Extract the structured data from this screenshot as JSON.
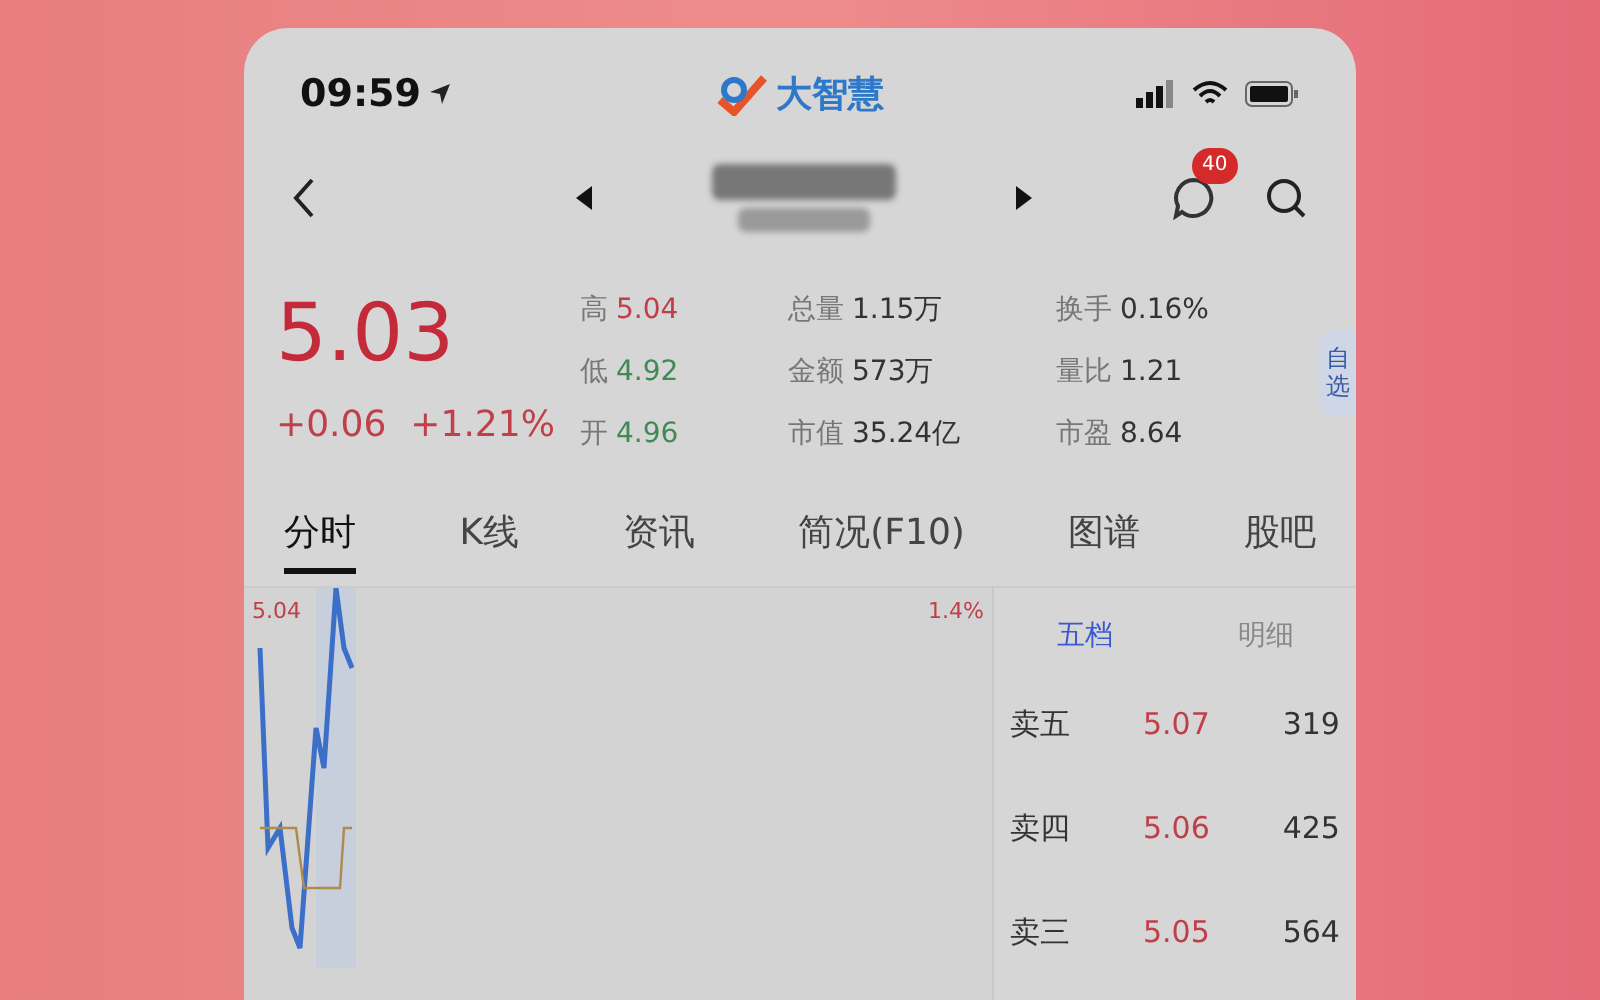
{
  "status_bar": {
    "time": "09:59",
    "logo_text": "大智慧"
  },
  "nav": {
    "message_badge": "40"
  },
  "quote": {
    "price": "5.03",
    "change": "+0.06",
    "change_pct": "+1.21%",
    "stats": [
      [
        {
          "label": "高",
          "value": "5.04",
          "color": "#c0404a"
        },
        {
          "label": "低",
          "value": "4.92",
          "color": "#3f8a55"
        },
        {
          "label": "开",
          "value": "4.96",
          "color": "#3f8a55"
        }
      ],
      [
        {
          "label": "总量",
          "value": "1.15万",
          "color": "#333333"
        },
        {
          "label": "金额",
          "value": "573万",
          "color": "#333333"
        },
        {
          "label": "市值",
          "value": "35.24亿",
          "color": "#333333"
        }
      ],
      [
        {
          "label": "换手",
          "value": "0.16%",
          "color": "#333333"
        },
        {
          "label": "量比",
          "value": "1.21",
          "color": "#333333"
        },
        {
          "label": "市盈",
          "value": "8.64",
          "color": "#333333"
        }
      ]
    ],
    "side_tab": "自选"
  },
  "tabs": [
    {
      "label": "分时",
      "selected": true
    },
    {
      "label": "K线",
      "selected": false
    },
    {
      "label": "资讯",
      "selected": false
    },
    {
      "label": "简况(F10)",
      "selected": false
    },
    {
      "label": "图谱",
      "selected": false
    },
    {
      "label": "股吧",
      "selected": false
    }
  ],
  "chart": {
    "top_price": "5.04",
    "top_pct": "1.4%"
  },
  "order_book": {
    "tabs": [
      {
        "label": "五档",
        "selected": true
      },
      {
        "label": "明细",
        "selected": false
      }
    ],
    "rows": [
      {
        "label": "卖五",
        "price": "5.07",
        "volume": "319"
      },
      {
        "label": "卖四",
        "price": "5.06",
        "volume": "425"
      },
      {
        "label": "卖三",
        "price": "5.05",
        "volume": "564"
      }
    ]
  }
}
